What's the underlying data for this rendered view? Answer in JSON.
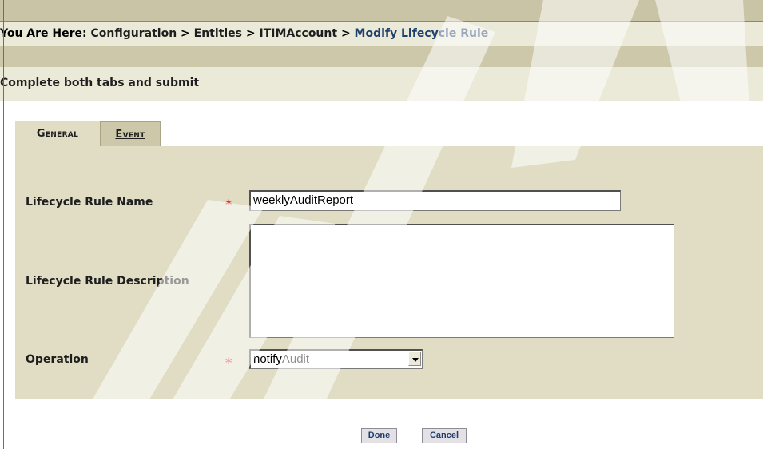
{
  "breadcrumb": {
    "prefix": "You Are Here:",
    "items": [
      "Configuration",
      "Entities",
      "ITIMAccount"
    ],
    "separator": ">",
    "current": "Modify Lifecycle Rule"
  },
  "instruction": "Complete both tabs and submit",
  "tabs": [
    {
      "label": "General",
      "selected": true
    },
    {
      "label": "Event",
      "selected": false
    }
  ],
  "form": {
    "name_label": "Lifecycle Rule Name",
    "name_value": "weeklyAuditReport",
    "description_label": "Lifecycle Rule Description",
    "description_value": "",
    "operation_label": "Operation",
    "operation_value": "notifyAudit",
    "required_marker": "*"
  },
  "buttons": {
    "done": "Done",
    "cancel": "Cancel"
  },
  "colors": {
    "required": "#e03030",
    "panel": "#e0ddc4",
    "breadcrumb_current": "#1f3f6e"
  }
}
